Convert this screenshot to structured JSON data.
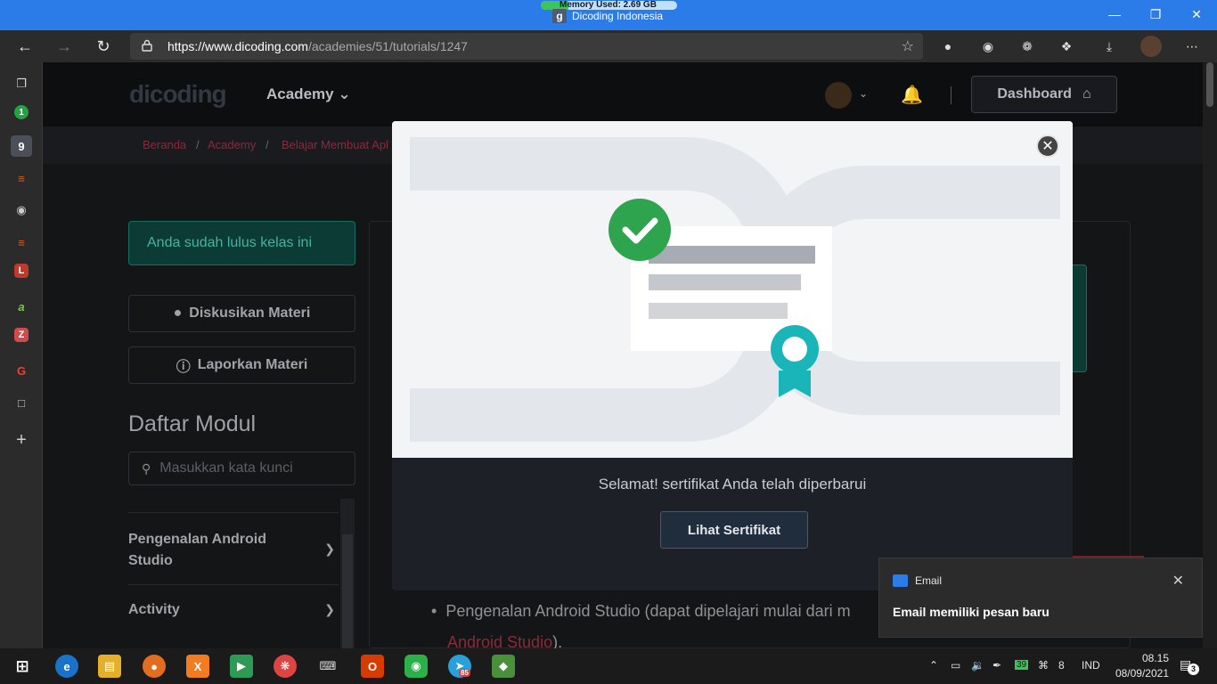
{
  "window": {
    "title": "Dicoding Indonesia",
    "memory_label": "Memory Used: 2.69 GB",
    "favicon_letter": "g"
  },
  "browser": {
    "url_host": "https://www.dicoding.com",
    "url_path": "/academies/51/tutorials/1247"
  },
  "site": {
    "logo_text": "dicoding",
    "nav_academy": "Academy",
    "dashboard_label": "Dashboard",
    "breadcrumbs": [
      "Beranda",
      "Academy",
      "Belajar Membuat Apl"
    ]
  },
  "sidebar": {
    "passed_text": "Anda sudah lulus kelas ini",
    "discuss_label": "Diskusikan Materi",
    "report_label": "Laporkan Materi",
    "modules_title": "Daftar Modul",
    "search_placeholder": "Masukkan kata kunci",
    "modules": [
      {
        "label": "Pengenalan Android Studio"
      },
      {
        "label": "Activity"
      }
    ]
  },
  "content": {
    "bullet_text": "Pengenalan Android Studio (dapat dipelajari mulai dari m",
    "link_text": "Android Studio",
    "link_suffix": ")."
  },
  "modal": {
    "message": "Selamat! sertifikat Anda telah diperbarui",
    "button_label": "Lihat Sertifikat",
    "colors": {
      "check": "#2ea44f",
      "ribbon": "#19b5b8"
    }
  },
  "toast": {
    "app_name": "Email",
    "message": "Email memiliki pesan baru"
  },
  "taskbar": {
    "telegram_badge": "85",
    "battery_label": "39",
    "language": "IND",
    "time": "08.15",
    "date": "08/09/2021",
    "notification_count": "3"
  }
}
